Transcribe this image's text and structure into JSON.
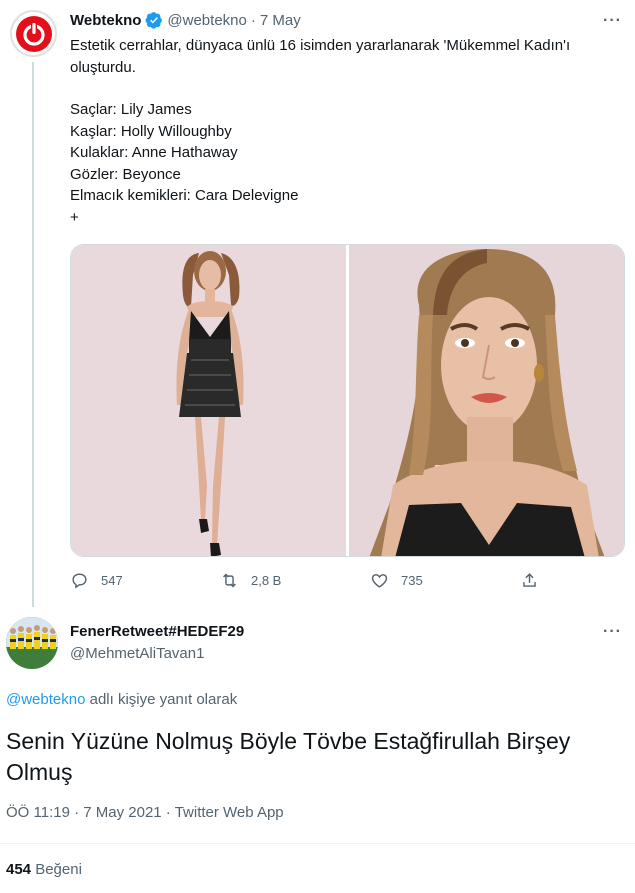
{
  "tweet": {
    "author_name": "Webtekno",
    "author_handle": "@webtekno",
    "separator": "·",
    "date": "7 May",
    "more": "···",
    "lines": [
      "Estetik cerrahlar, dünyaca ünlü 16 isimden yararlanarak 'Mükemmel Kadın'ı oluşturdu.",
      "",
      "Saçlar: Lily James",
      "Kaşlar: Holly Willoughby",
      "Kulaklar: Anne Hathaway",
      "Gözler: Beyonce",
      "Elmacık kemikleri: Cara Delevigne",
      "+"
    ],
    "actions": {
      "replies": "547",
      "retweets": "2,8 B",
      "likes": "735"
    },
    "icons": [
      "reply-icon",
      "retweet-icon",
      "like-icon",
      "share-icon",
      "verified-icon",
      "more-icon",
      "webtekno-logo-icon"
    ],
    "accent": "#e3101b",
    "verified_color": "#1d9bf0"
  },
  "reply": {
    "author_name": "FenerRetweet#HEDEF29",
    "author_handle": "@MehmetAliTavan1",
    "more": "···",
    "reply_to_mention": "@webtekno",
    "reply_to_suffix": " adlı kişiye yanıt olarak",
    "text": "Senin Yüzüne Nolmuş Böyle Tövbe Estağfirullah Birşey Olmuş",
    "meta": "ÖÖ 11:19 · 7 May 2021 · Twitter Web App",
    "like_count": "454",
    "like_label": " Beğeni"
  }
}
